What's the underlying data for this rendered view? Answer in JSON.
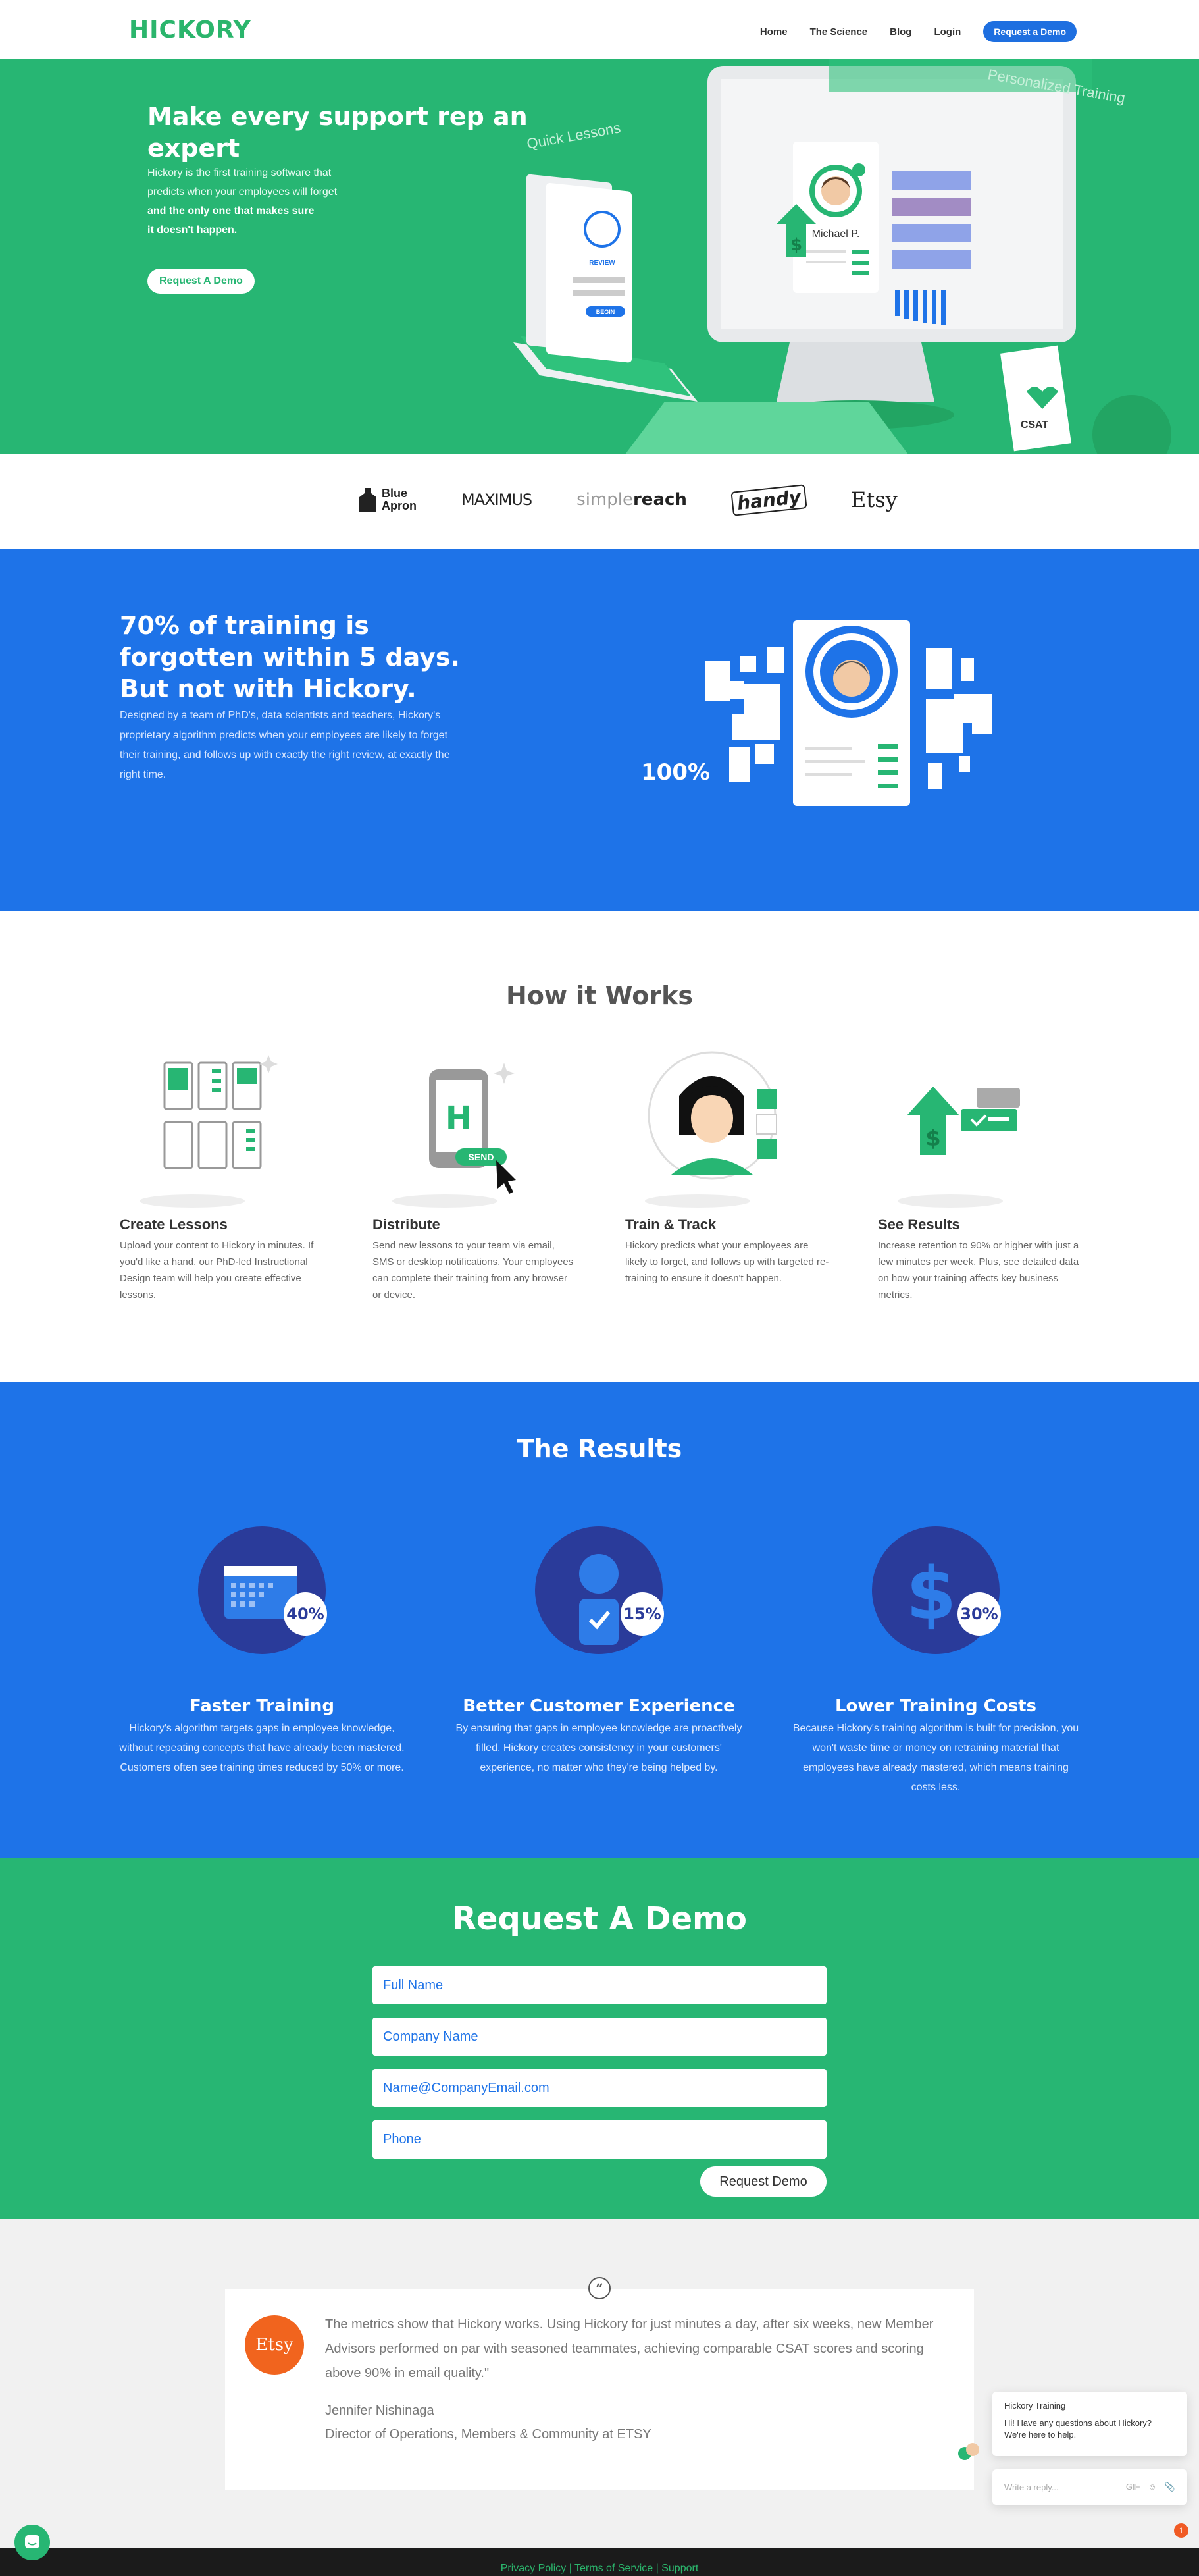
{
  "nav": {
    "logo": "HICKORY",
    "links": [
      "Home",
      "The Science",
      "Blog",
      "Login"
    ],
    "cta": "Request a Demo"
  },
  "hero": {
    "title": "Make every support rep an expert",
    "line1": "Hickory is the first training software that",
    "line2": "predicts when your employees will forget",
    "line3": "and the only one that makes sure",
    "line4": "it doesn't happen.",
    "button": "Request A Demo",
    "art": {
      "quick_lessons": "Quick Lessons",
      "personalized": "Personalized Training",
      "review": "REVIEW",
      "begin": "BEGIN",
      "person": "Michael P.",
      "csat": "CSAT"
    }
  },
  "logos": {
    "blue_apron_1": "Blue",
    "blue_apron_2": "Apron",
    "maximus": "MAXIMUS",
    "simplereach_a": "simple",
    "simplereach_b": "reach",
    "handy": "handy",
    "etsy": "Etsy"
  },
  "stat": {
    "title": "70% of training is forgotten within 5 days. But not with Hickory.",
    "body": "Designed by a team of PhD's, data scientists and teachers, Hickory's proprietary algorithm predicts when your employees are likely to forget their training, and follows up with exactly the right review, at exactly the right time.",
    "percent": "100%"
  },
  "how": {
    "title": "How it Works",
    "steps": [
      {
        "title": "Create Lessons",
        "body": "Upload your content to Hickory in minutes. If you'd like a hand, our PhD-led Instructional Design team will help you create effective lessons."
      },
      {
        "title": "Distribute",
        "body": "Send new lessons to your team via email, SMS or desktop notifications. Your employees can complete their training from any browser or device."
      },
      {
        "title": "Train & Track",
        "body": "Hickory predicts what your employees are likely to forget, and follows up with targeted re-training to ensure it doesn't happen."
      },
      {
        "title": "See Results",
        "body": "Increase retention to 90% or higher with just a few minutes per week. Plus, see detailed data on how your training affects key business metrics."
      }
    ],
    "send_label": "SEND",
    "h_letter": "H"
  },
  "results": {
    "title": "The Results",
    "items": [
      {
        "badge": "40%",
        "title": "Faster Training",
        "body": "Hickory's algorithm targets gaps in employee knowledge, without repeating concepts that have already been mastered. Customers often see training times reduced by 50% or more."
      },
      {
        "badge": "15%",
        "title": "Better Customer Experience",
        "body": "By ensuring that gaps in employee knowledge are proactively filled, Hickory creates consistency in your customers' experience, no matter who they're being helped by."
      },
      {
        "badge": "30%",
        "title": "Lower Training Costs",
        "body": "Because Hickory's training algorithm is built for precision, you won't waste time or money on retraining material that employees have already mastered, which means training costs less."
      }
    ]
  },
  "demo": {
    "title": "Request A Demo",
    "fields": [
      "Full Name",
      "Company Name",
      "Name@CompanyEmail.com",
      "Phone"
    ],
    "button": "Request Demo"
  },
  "testimonial": {
    "logo": "Etsy",
    "quote": "The metrics show that Hickory works. Using Hickory for just minutes a day, after six weeks, new Member Advisors performed on par with seasoned teammates, achieving comparable CSAT scores and scoring above 90% in email quality.\"",
    "name": "Jennifer Nishinaga",
    "role": "Director of Operations, Members & Community at ETSY"
  },
  "footer": {
    "privacy": "Privacy Policy",
    "terms": "Terms of Service",
    "support": "Support",
    "sep": " | "
  },
  "chat": {
    "title": "Hickory Training",
    "message": "Hi! Have any questions about Hickory? We're here to help.",
    "placeholder": "Write a reply...",
    "gif": "GIF",
    "count": "1"
  },
  "colors": {
    "green": "#27b673",
    "blue": "#1e73e8",
    "navy": "#2a3b9a",
    "etsy": "#f1641e"
  }
}
